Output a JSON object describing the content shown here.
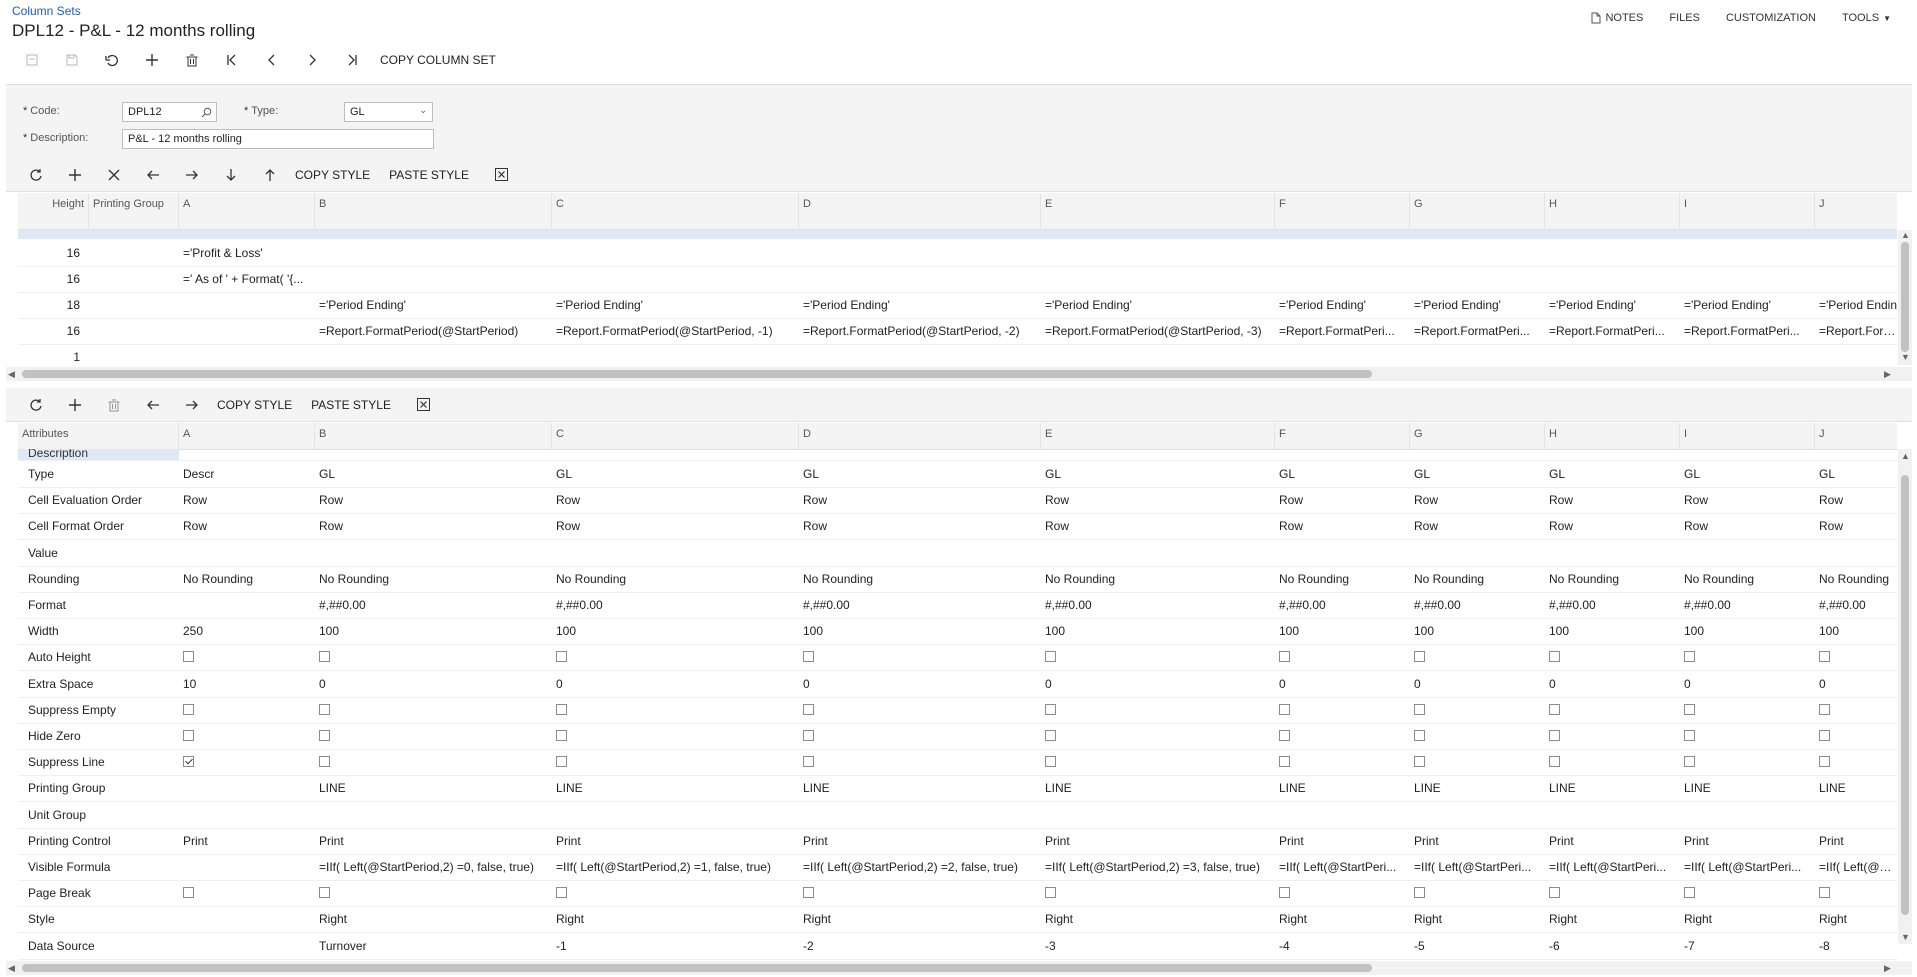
{
  "breadcrumb": "Column Sets",
  "title": "DPL12 - P&L - 12 months rolling",
  "topmenu": {
    "notes": "NOTES",
    "files": "FILES",
    "customization": "CUSTOMIZATION",
    "tools": "TOOLS"
  },
  "toolbar": {
    "copy_column_set": "COPY COLUMN SET"
  },
  "form": {
    "code_label": "Code:",
    "code_value": "DPL12",
    "type_label": "Type:",
    "type_value": "GL",
    "description_label": "Description:",
    "description_value": "P&L - 12 months rolling"
  },
  "grid1": {
    "copy_style": "COPY STYLE",
    "paste_style": "PASTE STYLE",
    "headers": [
      "Height",
      "Printing Group",
      "A",
      "B",
      "C",
      "D",
      "E",
      "F",
      "G",
      "H",
      "I",
      "J"
    ],
    "rows": [
      [
        "16",
        "",
        "='Profit & Loss'",
        "",
        "",
        "",
        "",
        "",
        "",
        "",
        "",
        ""
      ],
      [
        "16",
        "",
        "=' As of ' + Format( '{...",
        "",
        "",
        "",
        "",
        "",
        "",
        "",
        "",
        ""
      ],
      [
        "18",
        "",
        "",
        "='Period Ending'",
        "='Period Ending'",
        "='Period Ending'",
        "='Period Ending'",
        "='Period Ending'",
        "='Period Ending'",
        "='Period Ending'",
        "='Period Ending'",
        "='Period Endin"
      ],
      [
        "16",
        "",
        "",
        "=Report.FormatPeriod(@StartPeriod)",
        "=Report.FormatPeriod(@StartPeriod, -1)",
        "=Report.FormatPeriod(@StartPeriod, -2)",
        "=Report.FormatPeriod(@StartPeriod, -3)",
        "=Report.FormatPeri...",
        "=Report.FormatPeri...",
        "=Report.FormatPeri...",
        "=Report.FormatPeri...",
        "=Report.Forma"
      ],
      [
        "1",
        "",
        "",
        "",
        "",
        "",
        "",
        "",
        "",
        "",
        "",
        ""
      ]
    ]
  },
  "grid2": {
    "copy_style": "COPY STYLE",
    "paste_style": "PASTE STYLE",
    "headers": [
      "Attributes",
      "A",
      "B",
      "C",
      "D",
      "E",
      "F",
      "G",
      "H",
      "I",
      "J"
    ],
    "partial_row": "Description",
    "rows": [
      [
        "Type",
        "Descr",
        "GL",
        "GL",
        "GL",
        "GL",
        "GL",
        "GL",
        "GL",
        "GL",
        "GL"
      ],
      [
        "Cell Evaluation Order",
        "Row",
        "Row",
        "Row",
        "Row",
        "Row",
        "Row",
        "Row",
        "Row",
        "Row",
        "Row"
      ],
      [
        "Cell Format Order",
        "Row",
        "Row",
        "Row",
        "Row",
        "Row",
        "Row",
        "Row",
        "Row",
        "Row",
        "Row"
      ],
      [
        "Value",
        "",
        "",
        "",
        "",
        "",
        "",
        "",
        "",
        "",
        ""
      ],
      [
        "Rounding",
        "No Rounding",
        "No Rounding",
        "No Rounding",
        "No Rounding",
        "No Rounding",
        "No Rounding",
        "No Rounding",
        "No Rounding",
        "No Rounding",
        "No Rounding"
      ],
      [
        "Format",
        "",
        "#,##0.00",
        "#,##0.00",
        "#,##0.00",
        "#,##0.00",
        "#,##0.00",
        "#,##0.00",
        "#,##0.00",
        "#,##0.00",
        "#,##0.00"
      ],
      [
        "Width",
        "250",
        "100",
        "100",
        "100",
        "100",
        "100",
        "100",
        "100",
        "100",
        "100"
      ],
      [
        "Auto Height",
        "[ ]",
        "[ ]",
        "[ ]",
        "[ ]",
        "[ ]",
        "[ ]",
        "[ ]",
        "[ ]",
        "[ ]",
        "[ ]"
      ],
      [
        "Extra Space",
        "10",
        "0",
        "0",
        "0",
        "0",
        "0",
        "0",
        "0",
        "0",
        "0"
      ],
      [
        "Suppress Empty",
        "[ ]",
        "[ ]",
        "[ ]",
        "[ ]",
        "[ ]",
        "[ ]",
        "[ ]",
        "[ ]",
        "[ ]",
        "[ ]"
      ],
      [
        "Hide Zero",
        "[ ]",
        "[ ]",
        "[ ]",
        "[ ]",
        "[ ]",
        "[ ]",
        "[ ]",
        "[ ]",
        "[ ]",
        "[ ]"
      ],
      [
        "Suppress Line",
        "[x]",
        "[ ]",
        "[ ]",
        "[ ]",
        "[ ]",
        "[ ]",
        "[ ]",
        "[ ]",
        "[ ]",
        "[ ]"
      ],
      [
        "Printing Group",
        "",
        "LINE",
        "LINE",
        "LINE",
        "LINE",
        "LINE",
        "LINE",
        "LINE",
        "LINE",
        "LINE"
      ],
      [
        "Unit Group",
        "",
        "",
        "",
        "",
        "",
        "",
        "",
        "",
        "",
        ""
      ],
      [
        "Printing Control",
        "Print",
        "Print",
        "Print",
        "Print",
        "Print",
        "Print",
        "Print",
        "Print",
        "Print",
        "Print"
      ],
      [
        "Visible Formula",
        "",
        "=IIf( Left(@StartPeriod,2) =0, false, true)",
        "=IIf( Left(@StartPeriod,2) =1, false, true)",
        "=IIf( Left(@StartPeriod,2) =2, false, true)",
        "=IIf( Left(@StartPeriod,2) =3, false, true)",
        "=IIf( Left(@StartPeri...",
        "=IIf( Left(@StartPeri...",
        "=IIf( Left(@StartPeri...",
        "=IIf( Left(@StartPeri...",
        "=IIf( Left(@StartPe"
      ],
      [
        "Page Break",
        "[ ]",
        "[ ]",
        "[ ]",
        "[ ]",
        "[ ]",
        "[ ]",
        "[ ]",
        "[ ]",
        "[ ]",
        "[ ]"
      ],
      [
        "Style",
        "",
        "Right",
        "Right",
        "Right",
        "Right",
        "Right",
        "Right",
        "Right",
        "Right",
        "Right"
      ],
      [
        "Data Source",
        "",
        "Turnover",
        "-1",
        "-2",
        "-3",
        "-4",
        "-5",
        "-6",
        "-7",
        "-8"
      ]
    ]
  }
}
